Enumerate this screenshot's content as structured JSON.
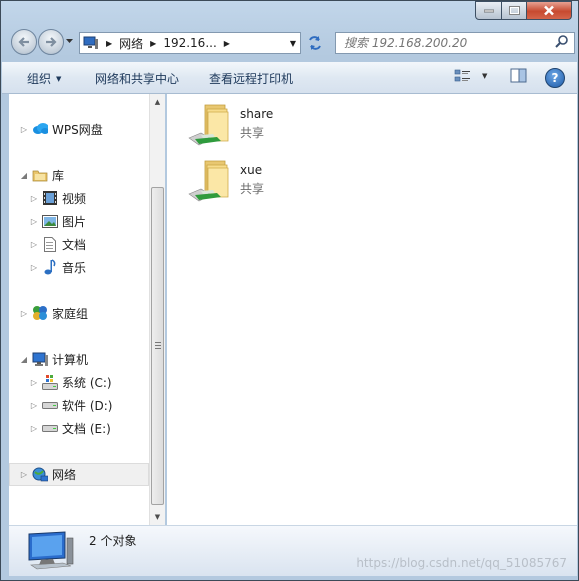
{
  "window": {
    "maximize_symbol": "□",
    "close_symbol": "✕",
    "minimize_symbol": "—"
  },
  "navigation": {
    "back_icon": "back-arrow-icon",
    "forward_icon": "forward-arrow-icon"
  },
  "address_bar": {
    "crumbs": [
      "网络",
      "192.16..."
    ],
    "computer_icon": "network-computer-icon"
  },
  "search": {
    "placeholder": "搜索 192.168.200.20"
  },
  "command_bar": {
    "organize": "组织",
    "network_sharing": "网络和共享中心",
    "view_printers": "查看远程打印机"
  },
  "sidebar": {
    "items": [
      {
        "label": "WPS网盘",
        "icon": "cloud-icon"
      },
      {
        "label": "库",
        "icon": "library-icon"
      },
      {
        "label": "视频",
        "icon": "video-icon"
      },
      {
        "label": "图片",
        "icon": "pictures-icon"
      },
      {
        "label": "文档",
        "icon": "documents-icon"
      },
      {
        "label": "音乐",
        "icon": "music-icon"
      },
      {
        "label": "家庭组",
        "icon": "homegroup-icon"
      },
      {
        "label": "计算机",
        "icon": "computer-icon"
      },
      {
        "label": "系统 (C:)",
        "icon": "system-drive-icon"
      },
      {
        "label": "软件 (D:)",
        "icon": "drive-icon"
      },
      {
        "label": "文档 (E:)",
        "icon": "drive-icon"
      },
      {
        "label": "网络",
        "icon": "network-icon"
      }
    ]
  },
  "content": {
    "items": [
      {
        "name": "share",
        "type": "共享"
      },
      {
        "name": "xue",
        "type": "共享"
      }
    ]
  },
  "details": {
    "count": "2 个对象"
  },
  "watermark": "https://blog.csdn.net/qq_51085767",
  "colors": {
    "accent": "#1e395b",
    "frame": "#b3c9df",
    "selected": "#f0f0f0"
  }
}
